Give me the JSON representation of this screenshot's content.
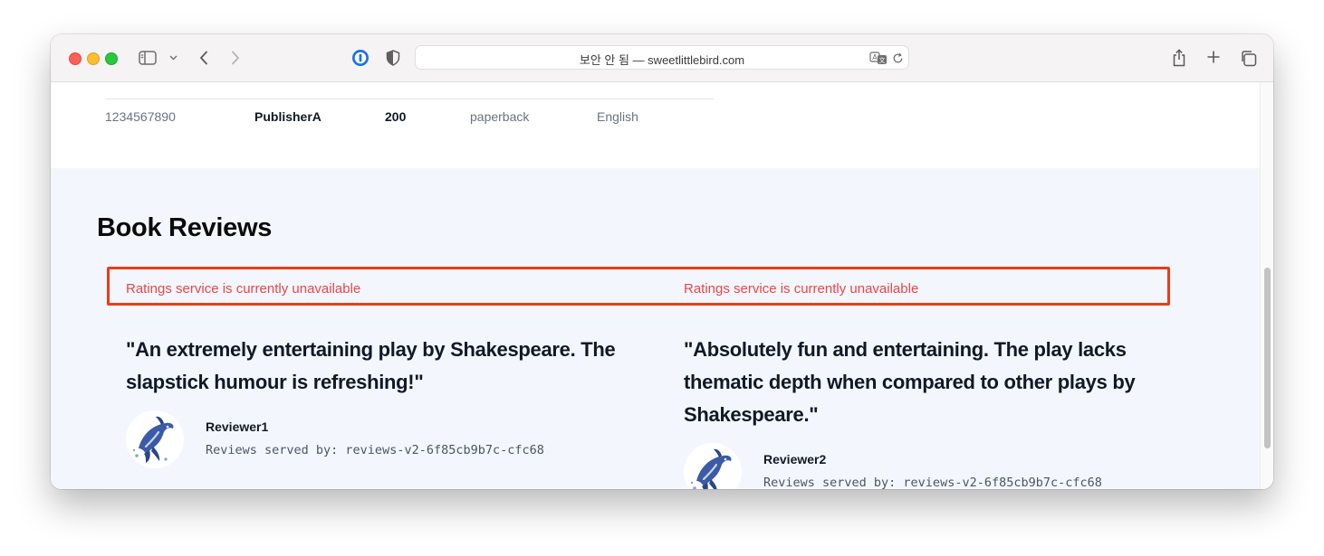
{
  "browser": {
    "url_display": "보안 안 됨 — sweetlittlebird.com"
  },
  "details_table": {
    "row": {
      "isbn": "1234567890",
      "publisher": "PublisherA",
      "pages": "200",
      "type": "paperback",
      "language": "English"
    }
  },
  "reviews_section": {
    "title": "Book Reviews",
    "ratings_messages": [
      "Ratings service is currently unavailable",
      "Ratings service is currently unavailable"
    ],
    "reviews": [
      {
        "text": "\"An extremely entertaining play by Shakespeare. The slapstick humour is refreshing!\"",
        "reviewer": "Reviewer1",
        "served_by": "Reviews served by: reviews-v2-6f85cb9b7c-cfc68"
      },
      {
        "text": "\"Absolutely fun and entertaining. The play lacks thematic depth when compared to other plays by Shakespeare.\"",
        "reviewer": "Reviewer2",
        "served_by": "Reviews served by: reviews-v2-6f85cb9b7c-cfc68"
      }
    ]
  },
  "colors": {
    "accent_red": "#ef4444",
    "highlight_outline": "#f03a17",
    "reviews_background": "#f3f7fd"
  }
}
